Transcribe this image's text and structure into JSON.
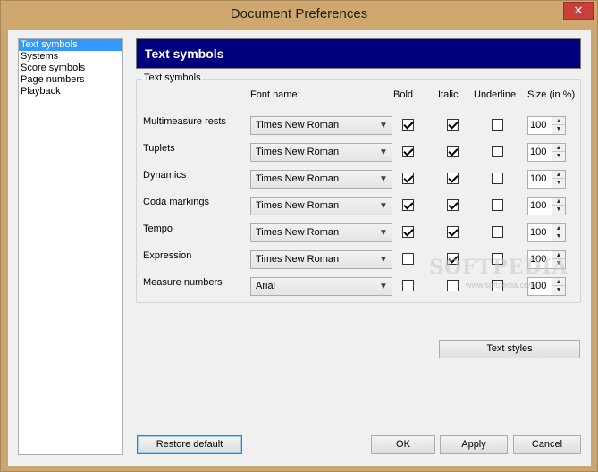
{
  "window": {
    "title": "Document Preferences",
    "close_glyph": "✕"
  },
  "nav": {
    "items": [
      {
        "label": "Text symbols",
        "selected": true
      },
      {
        "label": "Systems"
      },
      {
        "label": "Score symbols"
      },
      {
        "label": "Page numbers"
      },
      {
        "label": "Playback"
      }
    ]
  },
  "panel": {
    "header": "Text symbols",
    "group_label": "Text symbols",
    "columns": {
      "font": "Font name:",
      "bold": "Bold",
      "italic": "Italic",
      "underline": "Underline",
      "size": "Size (in %)"
    },
    "rows": [
      {
        "label": "Multimeasure rests",
        "font": "Times New Roman",
        "bold": true,
        "italic": true,
        "underline": false,
        "size": "100"
      },
      {
        "label": "Tuplets",
        "font": "Times New Roman",
        "bold": true,
        "italic": true,
        "underline": false,
        "size": "100"
      },
      {
        "label": "Dynamics",
        "font": "Times New Roman",
        "bold": true,
        "italic": true,
        "underline": false,
        "size": "100"
      },
      {
        "label": "Coda markings",
        "font": "Times New Roman",
        "bold": true,
        "italic": true,
        "underline": false,
        "size": "100"
      },
      {
        "label": "Tempo",
        "font": "Times New Roman",
        "bold": true,
        "italic": true,
        "underline": false,
        "size": "100"
      },
      {
        "label": "Expression",
        "font": "Times New Roman",
        "bold": false,
        "italic": true,
        "underline": false,
        "size": "100"
      },
      {
        "label": "Measure numbers",
        "font": "Arial",
        "bold": false,
        "italic": false,
        "underline": false,
        "size": "100"
      }
    ],
    "text_styles_button": "Text styles"
  },
  "footer": {
    "restore": "Restore default",
    "ok": "OK",
    "apply": "Apply",
    "cancel": "Cancel"
  },
  "watermark": {
    "brand": "SOFTPEDIA",
    "url": "www.softpedia.com"
  },
  "colors": {
    "title_bar": "#cfa86f",
    "header_bar": "#00007f",
    "selection": "#3399ff",
    "close": "#c7403a"
  },
  "icons": {
    "dropdown": "chevron-down-icon",
    "spin_up": "arrow-up-icon",
    "spin_down": "arrow-down-icon",
    "check": "checkmark-icon"
  }
}
